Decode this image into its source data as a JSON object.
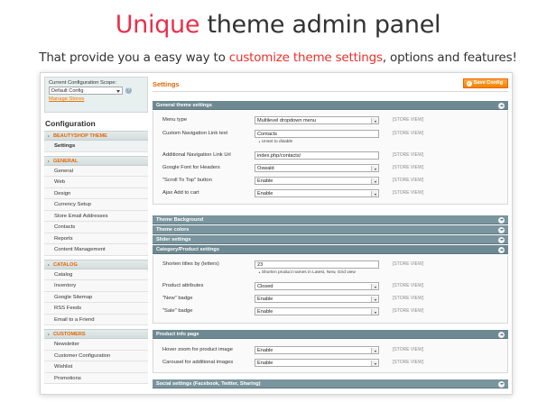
{
  "hero": {
    "title_accent": "Unique",
    "title_rest": " theme admin panel",
    "subtitle_pre": "That provide you a easy way to ",
    "subtitle_accent": "customize theme settings",
    "subtitle_post": ", options and features!"
  },
  "sidebar": {
    "scope_label": "Current Configuration Scope:",
    "scope_value": "Default Config",
    "manage_stores": "Manage Stores",
    "title": "Configuration",
    "sections": [
      {
        "label": "BEAUTYSHOP THEME",
        "items": [
          "Settings"
        ]
      },
      {
        "label": "GENERAL",
        "items": [
          "General",
          "Web",
          "Design",
          "Currency Setup",
          "Store Email Addresses",
          "Contacts",
          "Reports",
          "Content Management"
        ]
      },
      {
        "label": "CATALOG",
        "items": [
          "Catalog",
          "Inventory",
          "Google Sitemap",
          "RSS Feeds",
          "Email to a Friend"
        ]
      },
      {
        "label": "CUSTOMERS",
        "items": [
          "Newsletter",
          "Customer Configuration",
          "Wishlist",
          "Promotions"
        ]
      }
    ]
  },
  "main": {
    "title": "Settings",
    "save_label": "Save Config",
    "groups": {
      "general": "General theme settings",
      "background": "Theme Background",
      "colors": "Theme colors",
      "slider": "Slider settings",
      "category": "Category/Product settings",
      "product_info": "Product info page",
      "social": "Social settings (Facebook, Twitter, Sharing)"
    },
    "scope_tag": "[STORE VIEW]",
    "fields": {
      "menu_type": {
        "label": "Menu type",
        "value": "Multilevel dropdown menu"
      },
      "custom_nav": {
        "label": "Custom Navigation Link text",
        "value": "Contacts",
        "note": "Unset to disable"
      },
      "nav_url": {
        "label": "Additional Navigation Link Url",
        "value": "index.php/contacts/"
      },
      "google_font": {
        "label": "Google Font for Headers",
        "value": "Oswald"
      },
      "scroll_top": {
        "label": "\"Scroll To Top\" button",
        "value": "Enable"
      },
      "ajax_cart": {
        "label": "Ajax Add to cart",
        "value": "Enable"
      },
      "shorten": {
        "label": "Shorten titles by (letters)",
        "value": "23",
        "note": "Shorten product names in Latest, New, Grid view"
      },
      "attributes": {
        "label": "Product attributes",
        "value": "Closed"
      },
      "new_badge": {
        "label": "\"New\" badge",
        "value": "Enable"
      },
      "sale_badge": {
        "label": "\"Sale\" badge",
        "value": "Enable"
      },
      "hover_zoom": {
        "label": "Hover zoom for product image",
        "value": "Enable"
      },
      "carousel": {
        "label": "Carousel for additional images",
        "value": "Enable"
      }
    }
  }
}
